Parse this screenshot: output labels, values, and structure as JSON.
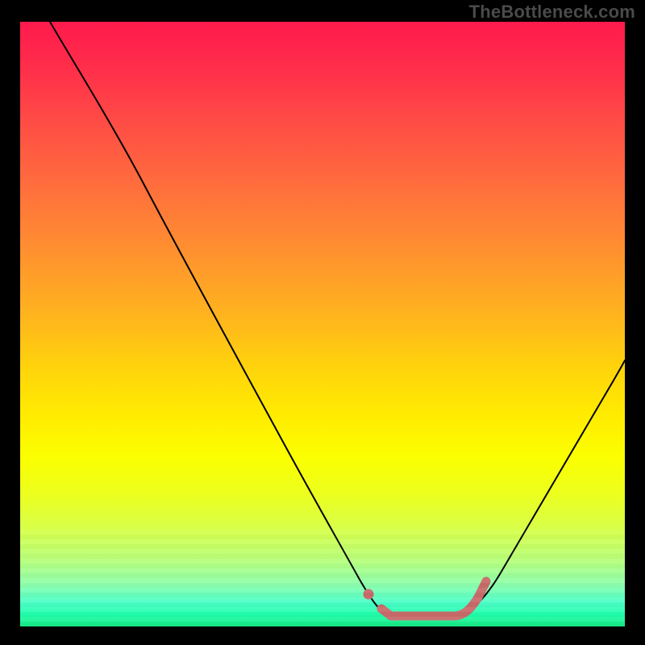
{
  "attribution": "TheBottleneck.com",
  "chart_data": {
    "type": "line",
    "title": "",
    "xlabel": "",
    "ylabel": "",
    "xlim": [
      0,
      100
    ],
    "ylim": [
      0,
      100
    ],
    "grid": false,
    "legend": false,
    "series": [
      {
        "name": "bottleneck-curve",
        "x": [
          5,
          12,
          20,
          30,
          40,
          50,
          56,
          60,
          64,
          68,
          72,
          78,
          85,
          92,
          100
        ],
        "y": [
          100,
          88,
          74,
          56,
          38,
          20,
          10,
          6,
          3,
          2,
          2,
          6,
          20,
          40,
          60
        ],
        "style": "thin-black"
      },
      {
        "name": "optimal-range-marker",
        "x": [
          60,
          64,
          68,
          72
        ],
        "y": [
          3,
          2,
          2,
          6
        ],
        "style": "thick-salmon"
      }
    ],
    "markers": [
      {
        "name": "optimal-start-dot",
        "x": 57,
        "y": 6
      }
    ],
    "colors": {
      "curve": "#000000",
      "marker": "#c96a6a",
      "gradient_top": "#ff1a4d",
      "gradient_mid": "#ffee00",
      "gradient_bottom": "#17e884"
    }
  }
}
